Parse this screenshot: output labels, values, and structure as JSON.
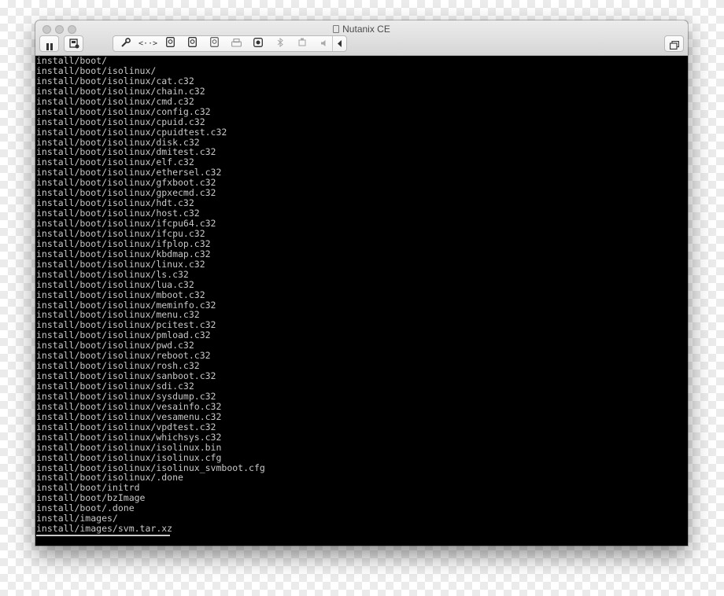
{
  "window": {
    "title": "Nutanix CE"
  },
  "toolbar": {
    "left_icons": [
      "pause-icon",
      "snapshot-icon"
    ],
    "group_icons": [
      "wrench-icon",
      "network-icon",
      "hard-disk-icon",
      "hard-disk-icon",
      "hard-disk-icon",
      "printer-icon",
      "camera-icon",
      "bluetooth-icon",
      "usb-icon",
      "chevron-left-icon"
    ],
    "right_icons": [
      "fullscreen-icon"
    ]
  },
  "terminal": {
    "lines": [
      "install/boot/",
      "install/boot/isolinux/",
      "install/boot/isolinux/cat.c32",
      "install/boot/isolinux/chain.c32",
      "install/boot/isolinux/cmd.c32",
      "install/boot/isolinux/config.c32",
      "install/boot/isolinux/cpuid.c32",
      "install/boot/isolinux/cpuidtest.c32",
      "install/boot/isolinux/disk.c32",
      "install/boot/isolinux/dmitest.c32",
      "install/boot/isolinux/elf.c32",
      "install/boot/isolinux/ethersel.c32",
      "install/boot/isolinux/gfxboot.c32",
      "install/boot/isolinux/gpxecmd.c32",
      "install/boot/isolinux/hdt.c32",
      "install/boot/isolinux/host.c32",
      "install/boot/isolinux/ifcpu64.c32",
      "install/boot/isolinux/ifcpu.c32",
      "install/boot/isolinux/ifplop.c32",
      "install/boot/isolinux/kbdmap.c32",
      "install/boot/isolinux/linux.c32",
      "install/boot/isolinux/ls.c32",
      "install/boot/isolinux/lua.c32",
      "install/boot/isolinux/mboot.c32",
      "install/boot/isolinux/meminfo.c32",
      "install/boot/isolinux/menu.c32",
      "install/boot/isolinux/pcitest.c32",
      "install/boot/isolinux/pmload.c32",
      "install/boot/isolinux/pwd.c32",
      "install/boot/isolinux/reboot.c32",
      "install/boot/isolinux/rosh.c32",
      "install/boot/isolinux/sanboot.c32",
      "install/boot/isolinux/sdi.c32",
      "install/boot/isolinux/sysdump.c32",
      "install/boot/isolinux/vesainfo.c32",
      "install/boot/isolinux/vesamenu.c32",
      "install/boot/isolinux/vpdtest.c32",
      "install/boot/isolinux/whichsys.c32",
      "install/boot/isolinux/isolinux.bin",
      "install/boot/isolinux/isolinux.cfg",
      "install/boot/isolinux/isolinux_svmboot.cfg",
      "install/boot/isolinux/.done",
      "install/boot/initrd",
      "install/boot/bzImage",
      "install/boot/.done",
      "install/images/",
      "install/images/svm.tar.xz"
    ]
  }
}
